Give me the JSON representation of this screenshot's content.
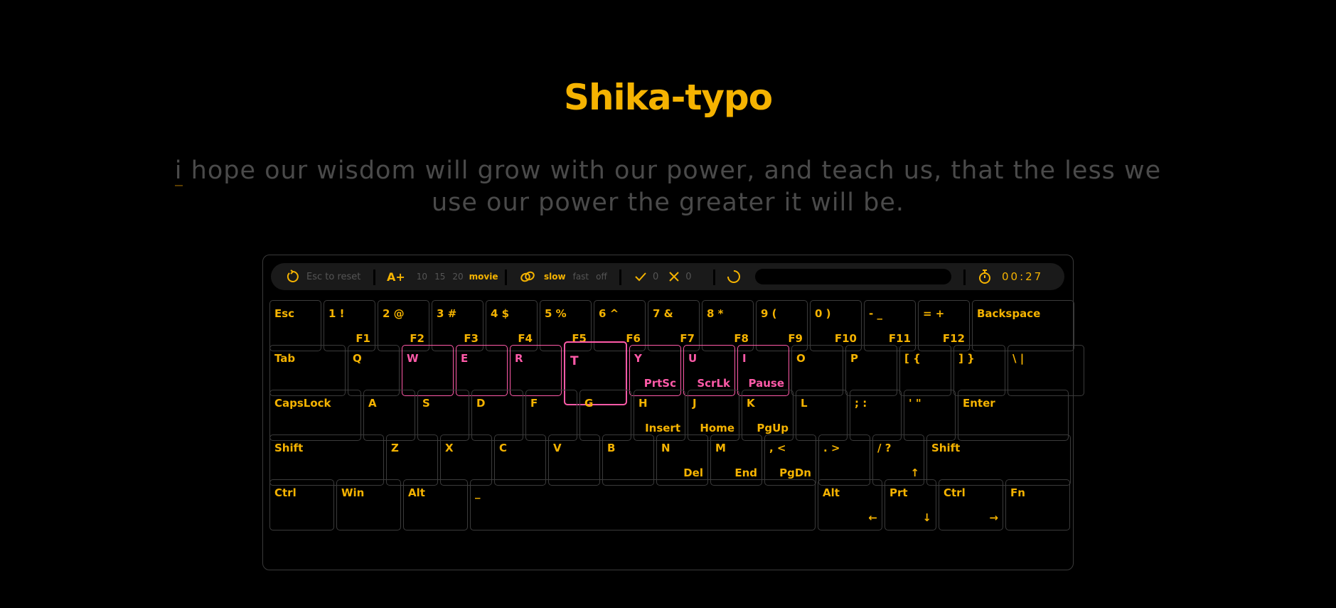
{
  "app": {
    "title": "Shika-typo"
  },
  "quote": {
    "typed": "i",
    "rest": " hope our wisdom will grow with our power, and teach us, that the less we use our power the greater it will be."
  },
  "toolbar": {
    "reset_label": "Esc to reset",
    "font_size_label": "A+",
    "word_counts": [
      "10",
      "15",
      "20"
    ],
    "mode_label": "movie",
    "speed": {
      "slow": "slow",
      "fast": "fast",
      "off": "off"
    },
    "correct_count": "0",
    "wrong_count": "0",
    "timer": "00:27"
  },
  "colors": {
    "accent": "#f5b301",
    "highlight": "#ff5aa8",
    "background": "#000000",
    "muted_text": "#4a4a4a"
  },
  "keyboard": {
    "rows": [
      [
        {
          "label": "Esc",
          "sub": ""
        },
        {
          "label": "1 !",
          "sub": "F1"
        },
        {
          "label": "2 @",
          "sub": "F2"
        },
        {
          "label": "3 #",
          "sub": "F3"
        },
        {
          "label": "4 $",
          "sub": "F4"
        },
        {
          "label": "5 %",
          "sub": "F5"
        },
        {
          "label": "6 ^",
          "sub": "F6"
        },
        {
          "label": "7 &",
          "sub": "F7"
        },
        {
          "label": "8 *",
          "sub": "F8"
        },
        {
          "label": "9 (",
          "sub": "F9"
        },
        {
          "label": "0 )",
          "sub": "F10"
        },
        {
          "label": "- _",
          "sub": "F11"
        },
        {
          "label": "= +",
          "sub": "F12"
        },
        {
          "label": "Backspace",
          "sub": ""
        }
      ],
      [
        {
          "label": "Tab",
          "sub": ""
        },
        {
          "label": "Q",
          "sub": ""
        },
        {
          "label": "W",
          "sub": "",
          "state": "highlight"
        },
        {
          "label": "E",
          "sub": "",
          "state": "highlight"
        },
        {
          "label": "R",
          "sub": "",
          "state": "highlight"
        },
        {
          "label": "T",
          "sub": "",
          "state": "active"
        },
        {
          "label": "Y",
          "sub": "PrtSc",
          "state": "highlight"
        },
        {
          "label": "U",
          "sub": "ScrLk",
          "state": "highlight"
        },
        {
          "label": "I",
          "sub": "Pause",
          "state": "highlight"
        },
        {
          "label": "O",
          "sub": ""
        },
        {
          "label": "P",
          "sub": ""
        },
        {
          "label": "[ {",
          "sub": ""
        },
        {
          "label": "] }",
          "sub": ""
        },
        {
          "label": "\\ |",
          "sub": ""
        }
      ],
      [
        {
          "label": "CapsLock",
          "sub": ""
        },
        {
          "label": "A",
          "sub": ""
        },
        {
          "label": "S",
          "sub": ""
        },
        {
          "label": "D",
          "sub": ""
        },
        {
          "label": "F",
          "sub": ""
        },
        {
          "label": "G",
          "sub": ""
        },
        {
          "label": "H",
          "sub": "Insert"
        },
        {
          "label": "J",
          "sub": "Home"
        },
        {
          "label": "K",
          "sub": "PgUp"
        },
        {
          "label": "L",
          "sub": ""
        },
        {
          "label": "; :",
          "sub": ""
        },
        {
          "label": "' \"",
          "sub": ""
        },
        {
          "label": "Enter",
          "sub": ""
        }
      ],
      [
        {
          "label": "Shift",
          "sub": ""
        },
        {
          "label": "Z",
          "sub": ""
        },
        {
          "label": "X",
          "sub": ""
        },
        {
          "label": "C",
          "sub": ""
        },
        {
          "label": "V",
          "sub": ""
        },
        {
          "label": "B",
          "sub": ""
        },
        {
          "label": "N",
          "sub": "Del"
        },
        {
          "label": "M",
          "sub": "End"
        },
        {
          "label": ", <",
          "sub": "PgDn"
        },
        {
          "label": ". >",
          "sub": ""
        },
        {
          "label": "/ ?",
          "sub": "↑"
        },
        {
          "label": "Shift",
          "sub": ""
        }
      ],
      [
        {
          "label": "Ctrl",
          "sub": ""
        },
        {
          "label": "Win",
          "sub": ""
        },
        {
          "label": "Alt",
          "sub": ""
        },
        {
          "label": "_",
          "sub": ""
        },
        {
          "label": "Alt",
          "sub": "←"
        },
        {
          "label": "Prt",
          "sub": "↓"
        },
        {
          "label": "Ctrl",
          "sub": "→"
        },
        {
          "label": "Fn",
          "sub": ""
        }
      ]
    ]
  }
}
